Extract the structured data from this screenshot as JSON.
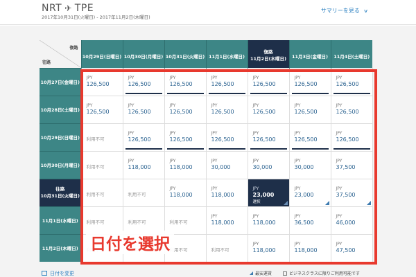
{
  "header": {
    "origin": "NRT",
    "plane_icon": "✈",
    "destination": "TPE",
    "date_range": "2017年10月31日(火曜日) - 2017年11月2日(木曜日)",
    "summary_link": "サマリーを見る",
    "chevron_icon": "chevron-down"
  },
  "grid": {
    "corner_outbound": "復路",
    "corner_return": "往路",
    "columns": [
      {
        "label": "10月29日(日曜日)",
        "tag": "",
        "selected": false
      },
      {
        "label": "10月30日(月曜日)",
        "tag": "",
        "selected": false
      },
      {
        "label": "10月31日(火曜日)",
        "tag": "",
        "selected": false
      },
      {
        "label": "11月1日(水曜日)",
        "tag": "",
        "selected": false
      },
      {
        "label": "11月2日(木曜日)",
        "tag": "復路",
        "selected": true
      },
      {
        "label": "11月3日(金曜日)",
        "tag": "",
        "selected": false
      },
      {
        "label": "11月4日(土曜日)",
        "tag": "",
        "selected": false
      }
    ],
    "rows": [
      {
        "label": "10月27日(金曜日)",
        "tag": "",
        "selected": false,
        "cells": [
          {
            "status": "price",
            "currency": "JPY",
            "price": "126,500",
            "bar": false,
            "tri": false
          },
          {
            "status": "price",
            "currency": "JPY",
            "price": "126,500",
            "bar": true,
            "tri": false
          },
          {
            "status": "price",
            "currency": "JPY",
            "price": "126,500",
            "bar": true,
            "tri": false
          },
          {
            "status": "price",
            "currency": "JPY",
            "price": "126,500",
            "bar": true,
            "tri": false
          },
          {
            "status": "price",
            "currency": "JPY",
            "price": "126,500",
            "bar": true,
            "tri": false
          },
          {
            "status": "price",
            "currency": "JPY",
            "price": "126,500",
            "bar": true,
            "tri": false
          },
          {
            "status": "price",
            "currency": "JPY",
            "price": "126,500",
            "bar": true,
            "tri": false
          }
        ]
      },
      {
        "label": "10月28日(土曜日)",
        "tag": "",
        "selected": false,
        "cells": [
          {
            "status": "price",
            "currency": "JPY",
            "price": "126,500",
            "bar": false,
            "tri": false
          },
          {
            "status": "price",
            "currency": "JPY",
            "price": "126,500",
            "bar": false,
            "tri": false
          },
          {
            "status": "price",
            "currency": "JPY",
            "price": "126,500",
            "bar": false,
            "tri": false
          },
          {
            "status": "price",
            "currency": "JPY",
            "price": "126,500",
            "bar": false,
            "tri": false
          },
          {
            "status": "price",
            "currency": "JPY",
            "price": "126,500",
            "bar": false,
            "tri": false
          },
          {
            "status": "price",
            "currency": "JPY",
            "price": "126,500",
            "bar": false,
            "tri": false
          },
          {
            "status": "price",
            "currency": "JPY",
            "price": "126,500",
            "bar": false,
            "tri": false
          }
        ]
      },
      {
        "label": "10月29日(日曜日)",
        "tag": "",
        "selected": false,
        "cells": [
          {
            "status": "na",
            "text": "利用不可"
          },
          {
            "status": "price",
            "currency": "JPY",
            "price": "126,500",
            "bar": true,
            "tri": false
          },
          {
            "status": "price",
            "currency": "JPY",
            "price": "126,500",
            "bar": true,
            "tri": false
          },
          {
            "status": "price",
            "currency": "JPY",
            "price": "126,500",
            "bar": true,
            "tri": false
          },
          {
            "status": "price",
            "currency": "JPY",
            "price": "126,500",
            "bar": true,
            "tri": false
          },
          {
            "status": "price",
            "currency": "JPY",
            "price": "126,500",
            "bar": true,
            "tri": false
          },
          {
            "status": "price",
            "currency": "JPY",
            "price": "126,500",
            "bar": true,
            "tri": false
          }
        ]
      },
      {
        "label": "10月30日(月曜日)",
        "tag": "",
        "selected": false,
        "cells": [
          {
            "status": "na",
            "text": "利用不可"
          },
          {
            "status": "price",
            "currency": "JPY",
            "price": "118,000",
            "bar": false,
            "tri": false
          },
          {
            "status": "price",
            "currency": "JPY",
            "price": "118,000",
            "bar": false,
            "tri": false
          },
          {
            "status": "price",
            "currency": "JPY",
            "price": "30,000",
            "bar": false,
            "tri": false
          },
          {
            "status": "price",
            "currency": "JPY",
            "price": "30,000",
            "bar": false,
            "tri": false
          },
          {
            "status": "price",
            "currency": "JPY",
            "price": "30,000",
            "bar": false,
            "tri": false
          },
          {
            "status": "price",
            "currency": "JPY",
            "price": "37,500",
            "bar": false,
            "tri": false
          }
        ]
      },
      {
        "label": "10月31日(火曜日)",
        "tag": "往路",
        "selected": true,
        "cells": [
          {
            "status": "na",
            "text": "利用不可"
          },
          {
            "status": "na",
            "text": "利用不可"
          },
          {
            "status": "price",
            "currency": "JPY",
            "price": "118,000",
            "bar": false,
            "tri": false
          },
          {
            "status": "price",
            "currency": "JPY",
            "price": "118,000",
            "bar": false,
            "tri": false
          },
          {
            "status": "price",
            "currency": "JPY",
            "price": "23,000",
            "note": "選択",
            "bar": false,
            "tri": true,
            "selected": true
          },
          {
            "status": "price",
            "currency": "JPY",
            "price": "23,000",
            "bar": false,
            "tri": true
          },
          {
            "status": "price",
            "currency": "JPY",
            "price": "37,500",
            "bar": false,
            "tri": true
          }
        ]
      },
      {
        "label": "11月1日(水曜日)",
        "tag": "",
        "selected": false,
        "cells": [
          {
            "status": "na",
            "text": "利用不可"
          },
          {
            "status": "na",
            "text": "利用不可"
          },
          {
            "status": "na",
            "text": "利用不可"
          },
          {
            "status": "price",
            "currency": "JPY",
            "price": "118,000",
            "bar": false,
            "tri": false
          },
          {
            "status": "price",
            "currency": "JPY",
            "price": "118,000",
            "bar": false,
            "tri": false
          },
          {
            "status": "price",
            "currency": "JPY",
            "price": "36,500",
            "bar": false,
            "tri": false
          },
          {
            "status": "price",
            "currency": "JPY",
            "price": "46,000",
            "bar": false,
            "tri": false
          }
        ]
      },
      {
        "label": "11月2日(木曜日)",
        "tag": "",
        "selected": false,
        "cells": [
          {
            "status": "na",
            "text": "利用不可"
          },
          {
            "status": "na",
            "text": "利用不可"
          },
          {
            "status": "na",
            "text": "利用不可"
          },
          {
            "status": "na",
            "text": "利用不可"
          },
          {
            "status": "price",
            "currency": "JPY",
            "price": "118,000",
            "bar": false,
            "tri": false
          },
          {
            "status": "price",
            "currency": "JPY",
            "price": "118,000",
            "bar": false,
            "tri": false
          },
          {
            "status": "price",
            "currency": "JPY",
            "price": "47,500",
            "bar": false,
            "tri": false
          }
        ]
      }
    ]
  },
  "overlay_label": "日付を選択",
  "footer": {
    "change_date": "日付を変更",
    "cheapest": "最安運賃",
    "business_only": "ビジネスクラスに限りご利用可能です"
  },
  "colors": {
    "teal_header": "#3d8686",
    "navy_selected": "#1e2f49",
    "price_text": "#2a6290",
    "annotation_red": "#e8392e",
    "link_blue": "#2a7fc0"
  }
}
